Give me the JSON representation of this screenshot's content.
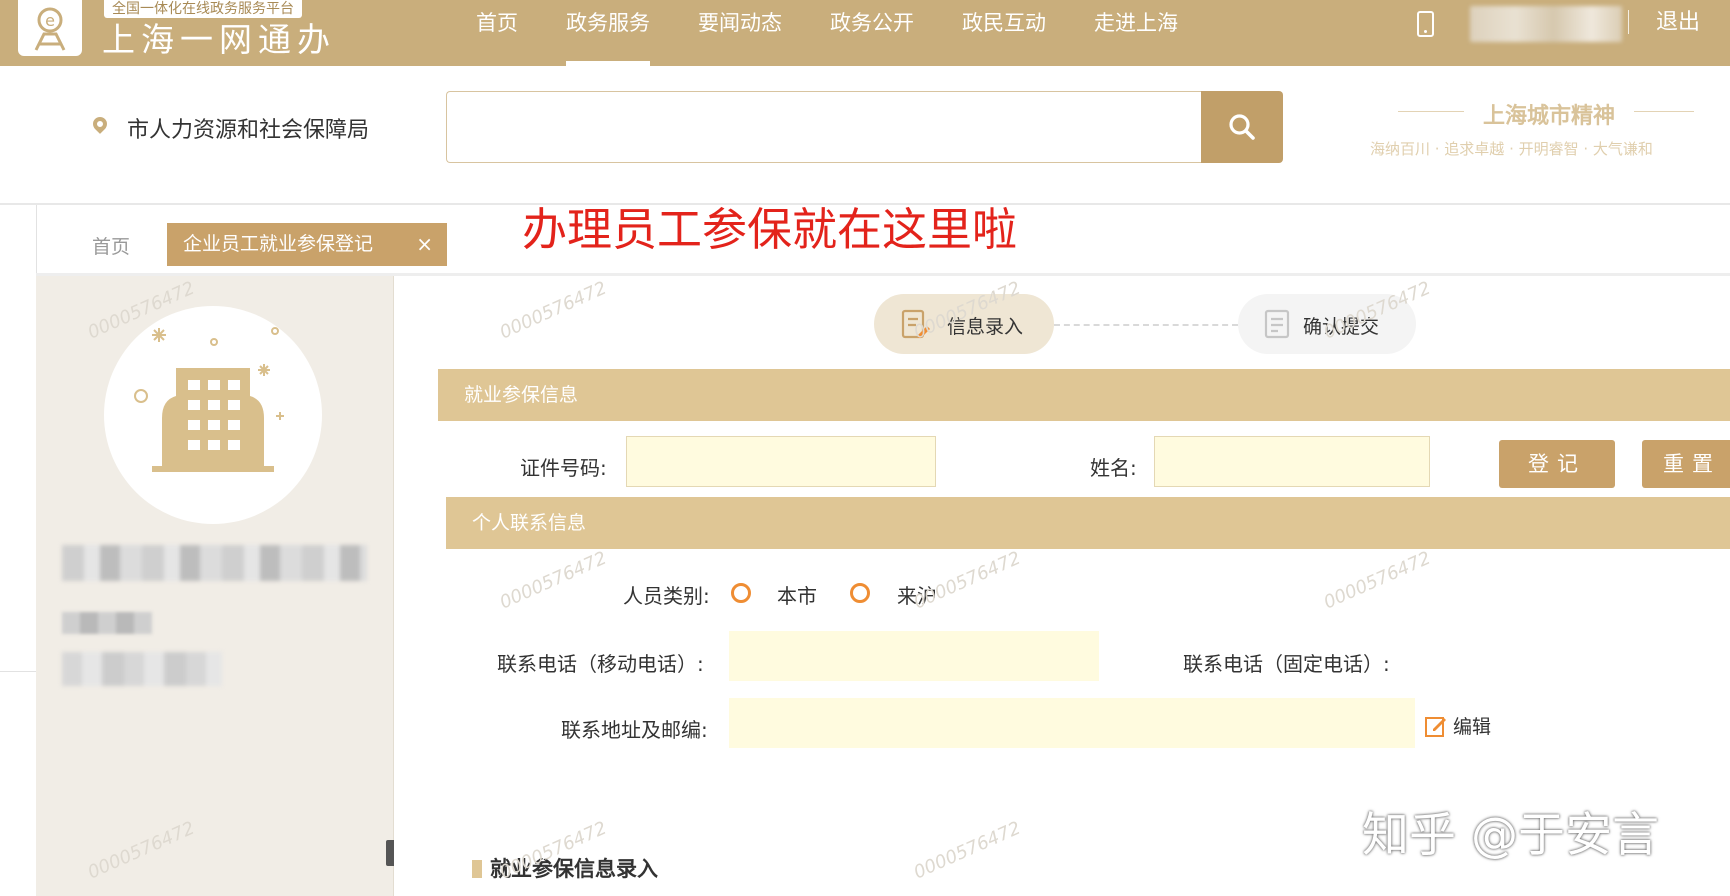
{
  "header": {
    "logo_sub": "全国一体化在线政务服务平台",
    "logo_main": "上海一网通办",
    "nav": [
      "首页",
      "政务服务",
      "要闻动态",
      "政务公开",
      "政民互动",
      "走进上海"
    ],
    "nav_active_index": 1,
    "logout": "退出"
  },
  "search": {
    "location": "市人力资源和社会保障局",
    "placeholder": "",
    "spirit_title": "上海城市精神",
    "spirit_sub": "海纳百川 · 追求卓越 · 开明睿智 · 大气谦和"
  },
  "tabs": {
    "home": "首页",
    "active": "企业员工就业参保登记",
    "close": "×"
  },
  "annotation": "办理员工参保就在这里啦",
  "steps": {
    "step1": "信息录入",
    "step2": "确认提交"
  },
  "section1": {
    "title": "就业参保信息",
    "id_label": "证件号码:",
    "id_value": "",
    "name_label": "姓名:",
    "name_value": "",
    "register_btn": "登记",
    "reset_btn": "重置"
  },
  "section2": {
    "title": "个人联系信息",
    "person_type_label": "人员类别:",
    "option_local": "本市",
    "option_nonlocal": "来沪",
    "mobile_label": "联系电话（移动电话）:",
    "mobile_value": "",
    "landline_label": "联系电话（固定电话）:",
    "address_label": "联系地址及邮编:",
    "address_value": "",
    "edit": "编辑"
  },
  "subsection_title": "就业参保信息录入",
  "watermark_text": "0000576472",
  "attribution": "知乎 @于安言",
  "colors": {
    "brand": "#c9ae7c",
    "section_bar": "#dfc695",
    "button": "#c9a26a",
    "input_fill": "#fffbdf",
    "annotation": "#e3231b",
    "radio": "#ef8d33"
  }
}
